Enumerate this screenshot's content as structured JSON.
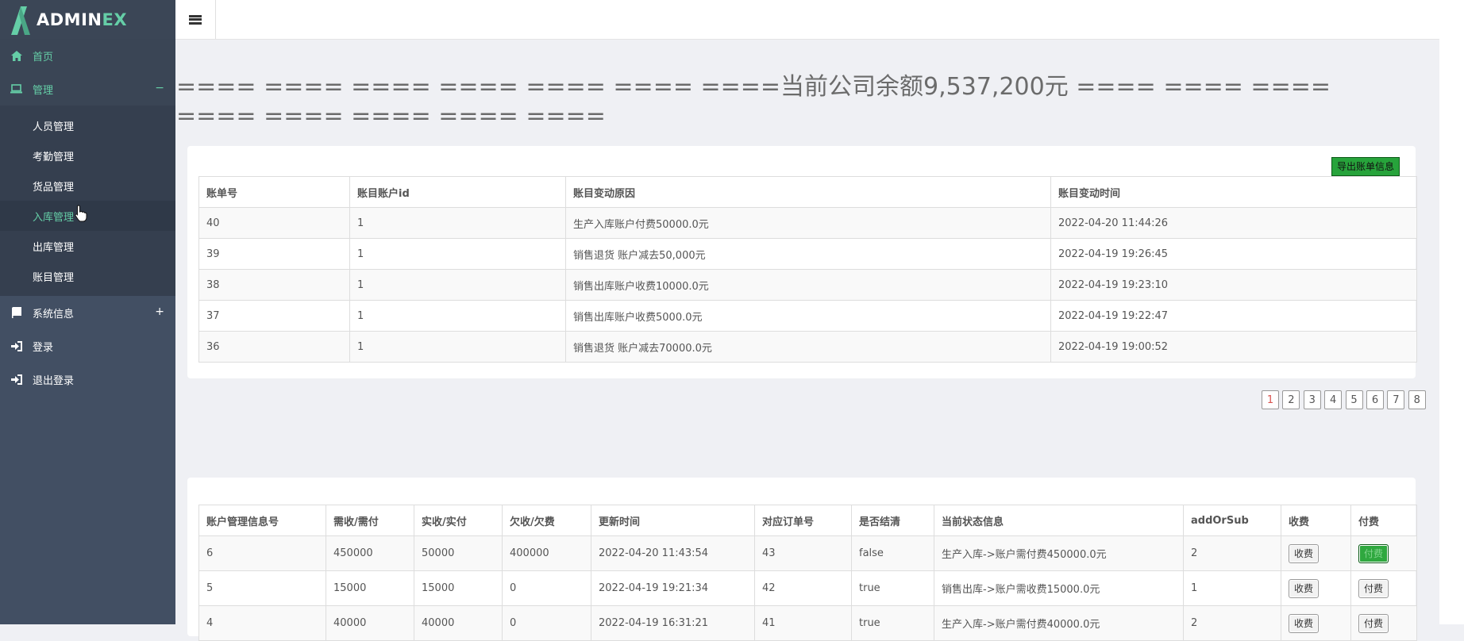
{
  "logo": {
    "main": "ADMIN",
    "accent": "EX"
  },
  "sidebar": {
    "home": "首页",
    "manage": {
      "label": "管理",
      "toggle": "−"
    },
    "sub_items": [
      "人员管理",
      "考勤管理",
      "货品管理",
      "入库管理",
      "出库管理",
      "账目管理"
    ],
    "system": {
      "label": "系统信息",
      "toggle": "+"
    },
    "login": "登录",
    "logout": "退出登录"
  },
  "balance_text": "==== ==== ==== ==== ==== ==== ====当前公司余额9,537,200元 ==== ==== ==== ==== ==== ==== ==== ====",
  "bill_panel": {
    "export_label": "导出账单信息",
    "headers": [
      "账单号",
      "账目账户id",
      "账目变动原因",
      "账目变动时间"
    ],
    "rows": [
      [
        "40",
        "1",
        "生产入库账户付费50000.0元",
        "2022-04-20 11:44:26"
      ],
      [
        "39",
        "1",
        "销售退货 账户减去50,000元",
        "2022-04-19 19:26:45"
      ],
      [
        "38",
        "1",
        "销售出库账户收费10000.0元",
        "2022-04-19 19:23:10"
      ],
      [
        "37",
        "1",
        "销售出库账户收费5000.0元",
        "2022-04-19 19:22:47"
      ],
      [
        "36",
        "1",
        "销售退货 账户减去70000.0元",
        "2022-04-19 19:00:52"
      ]
    ]
  },
  "pagination": {
    "pages": [
      "1",
      "2",
      "3",
      "4",
      "5",
      "6",
      "7",
      "8"
    ],
    "current": "1"
  },
  "account_panel": {
    "headers": [
      "账户管理信息号",
      "需收/需付",
      "实收/实付",
      "欠收/欠费",
      "更新时间",
      "对应订单号",
      "是否结清",
      "当前状态信息",
      "addOrSub",
      "收费",
      "付费"
    ],
    "rows": [
      [
        "6",
        "450000",
        "50000",
        "400000",
        "2022-04-20 11:43:54",
        "43",
        "false",
        "生产入库->账户需付费450000.0元",
        "2"
      ],
      [
        "5",
        "15000",
        "15000",
        "0",
        "2022-04-19 19:21:34",
        "42",
        "true",
        "销售出库->账户需收费15000.0元",
        "1"
      ],
      [
        "4",
        "40000",
        "40000",
        "0",
        "2022-04-19 16:31:21",
        "41",
        "true",
        "生产入库->账户需付费40000.0元",
        "2"
      ]
    ],
    "charge_label": "收费",
    "pay_label": "付费"
  }
}
